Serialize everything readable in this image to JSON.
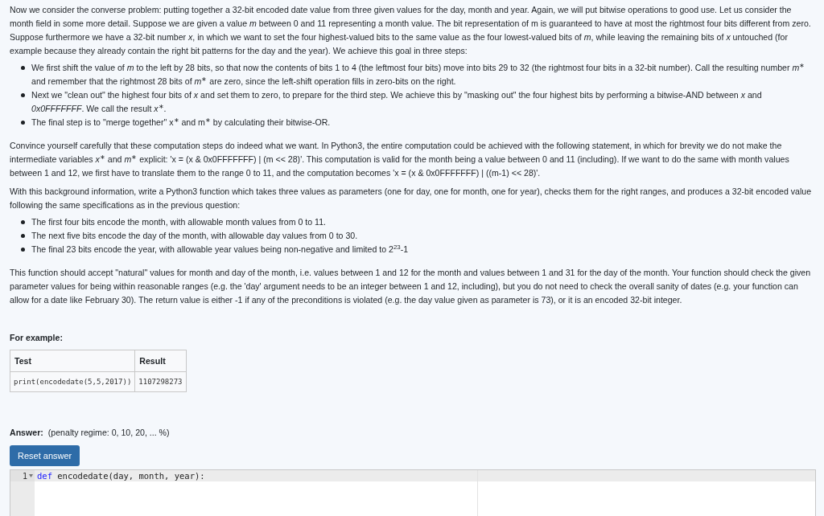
{
  "intro": "Now we consider the converse problem: putting together a 32-bit encoded date value from three given values for the day, month and year. Again, we will put bitwise operations to good use. Let us consider the month field in some more detail. Suppose we are given a value *m* between 0 and 11 representing a month value. The bit representation of m is guaranteed to have at most the rightmost four bits different from zero. Suppose furthermore we have a 32-bit number *x*, in which we want to set the four highest-valued bits to the same value as the four lowest-valued bits of *m*, while leaving the remaining bits of *x* untouched (for example because they already contain the right bit patterns for the day and the year). We achieve this goal in three steps:",
  "steps": [
    "We first shift the value of *m* to the left by 28 bits, so that now the contents of bits 1 to 4 (the leftmost four bits) move into bits 29 to 32 (the rightmost four bits in a 32-bit number). Call the resulting number *m*$^{∗}$ and remember that the rightmost 28 bits of *m*$^{∗}$ are zero, since the left-shift operation fills in zero-bits on the right.",
    "Next we \"clean out\" the highest four bits of *x* and set them to zero, to prepare for the third step. We achieve this by \"masking out\" the four highest bits by performing a bitwise-AND between *x* and *0x0FFFFFFF*. We call the result *x*$^{∗}$.",
    "The final step is to \"merge together\" x$^{∗}$ and m$^{∗}$ by calculating their bitwise-OR."
  ],
  "paragraphs": [
    "Convince yourself carefully that these computation steps do indeed what we want. In Python3, the entire computation could be achieved with the following statement, in which for brevity we do not make the intermediate variables *x*$^{∗}$ and *m*$^{∗}$ explicit: 'x = (x & 0x0FFFFFFF) | (m << 28)'. This computation is valid for the month being a value between 0 and 11 (including). If we want to do the same with month values between 1 and 12, we first have to translate them to the range 0 to 11, and the computation becomes 'x = (x & 0x0FFFFFFF) | ((m-1) << 28)'.",
    "With this background information, write a Python3 function which takes three values as parameters (one for day, one for month, one for year), checks them for the right ranges, and produces a 32-bit encoded value following the same specifications as in the previous question:"
  ],
  "specs": [
    "The first four bits encode the month, with allowable month values from 0 to 11.",
    "The next five bits encode the day of the month, with allowable day values from 0 to 30.",
    "The final 23 bits encode the year, with allowable year values being non-negative and limited to 2$^{23}$-1"
  ],
  "closing": "This function should accept \"natural\" values for month and day of the month, i.e. values between 1 and 12 for the month and values between 1 and 31 for the day of the month. Your function should check the given parameter values for being within reasonable ranges (e.g. the 'day' argument needs to be an integer between 1 and 12, including), but you do not need to check the overall sanity of dates (e.g. your function can allow for a date like February 30). The return value is either -1 if any of the preconditions is violated (e.g. the day value given as parameter is 73), or it is an encoded 32-bit integer.",
  "example": {
    "heading": "For example:",
    "columns": [
      "Test",
      "Result"
    ],
    "rows": [
      [
        "print(encodedate(5,5,2017))",
        "1107298273"
      ]
    ]
  },
  "answer": {
    "label": "Answer:",
    "penalty": "(penalty regime: 0, 10, 20, ... %)",
    "reset_button": "Reset answer",
    "editor": {
      "lines": [
        {
          "number": "1",
          "tokens": [
            {
              "kind": "keyword",
              "text": "def"
            },
            {
              "kind": "plain",
              "text": " encodedate(day, month, year):"
            }
          ]
        }
      ]
    }
  }
}
